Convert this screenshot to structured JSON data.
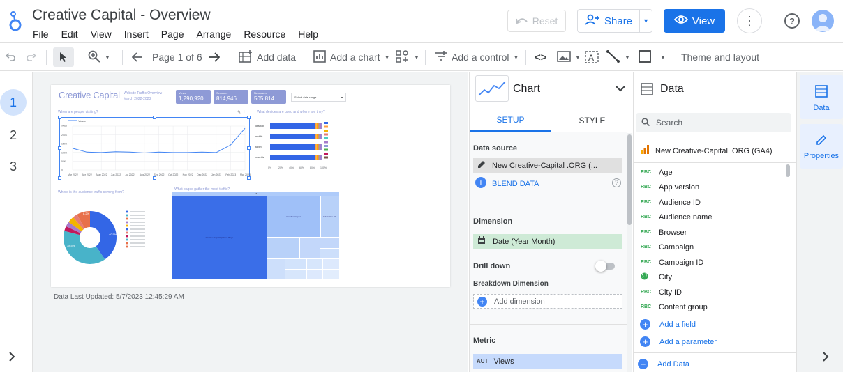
{
  "app": {
    "title": "Creative Capital - Overview",
    "menu": [
      "File",
      "Edit",
      "View",
      "Insert",
      "Page",
      "Arrange",
      "Resource",
      "Help"
    ],
    "reset_label": "Reset",
    "share_label": "Share",
    "view_label": "View"
  },
  "toolbar": {
    "page_indicator": "Page 1 of 6",
    "add_data": "Add data",
    "add_chart": "Add a chart",
    "add_control": "Add a control",
    "theme_layout": "Theme and layout"
  },
  "pages": [
    "1",
    "2",
    "3"
  ],
  "report": {
    "brand": "Creative Capital",
    "subtitle1": "Website Traffic Overview",
    "subtitle2": "March 2022-2023",
    "kpis": [
      {
        "label": "Views",
        "value": "1,290,920"
      },
      {
        "label": "Sessions",
        "value": "814,946"
      },
      {
        "label": "New users",
        "value": "505,814"
      }
    ],
    "date_selector": "Select date range",
    "q1": "When are people visiting?",
    "q2": "What devices are used and where are they?",
    "q3": "Where is the audience traffic coming from?",
    "q4": "What pages gather the most traffic?",
    "line_legend": "Views",
    "line_x": [
      "Mar 2022",
      "Apr 2022",
      "May 2022",
      "Jun 2022",
      "Jul 2022",
      "Aug 2022",
      "Sep 2022",
      "Oct 2022",
      "Nov 2022",
      "Dec 2022",
      "Jan 2023",
      "Feb 2023",
      "Mar 2023"
    ],
    "line_y_ticks": [
      "250K",
      "200K",
      "150K",
      "100K",
      "50K",
      "0"
    ],
    "device_categories": [
      "desktop",
      "mobile",
      "tablet",
      "smart tv"
    ],
    "device_x_ticks": [
      "0%",
      "20%",
      "40%",
      "60%",
      "80%",
      "100%"
    ],
    "pie_pct_large": "40.5%",
    "pie_pct_second": "38.5%",
    "pie_pct_third": "8.2%",
    "treemap_top": "All",
    "treemap_main": "Creative Capital | Home Page",
    "treemap_second": "Creative Capital",
    "treemap_third": "Education 101"
  },
  "last_updated": "Data Last Updated: 5/7/2023 12:45:29 AM",
  "chart_panel": {
    "title": "Chart",
    "tab_setup": "SETUP",
    "tab_style": "STYLE",
    "data_source_label": "Data source",
    "data_source_value": "New Creative-Capital .ORG (...",
    "blend_data": "BLEND DATA",
    "dimension_label": "Dimension",
    "dimension_value": "Date (Year Month)",
    "drill_down": "Drill down",
    "breakdown_label": "Breakdown Dimension",
    "add_dimension": "Add dimension",
    "metric_label": "Metric",
    "metric_tag": "AUT",
    "metric_value": "Views"
  },
  "data_panel": {
    "title": "Data",
    "search_placeholder": "Search",
    "source_name": "New Creative-Capital .ORG (GA4)",
    "fields": [
      {
        "type": "RBC",
        "name": "Age"
      },
      {
        "type": "RBC",
        "name": "App version"
      },
      {
        "type": "RBC",
        "name": "Audience ID"
      },
      {
        "type": "RBC",
        "name": "Audience name"
      },
      {
        "type": "RBC",
        "name": "Browser"
      },
      {
        "type": "RBC",
        "name": "Campaign"
      },
      {
        "type": "RBC",
        "name": "Campaign ID"
      },
      {
        "type": "geo",
        "name": "City"
      },
      {
        "type": "RBC",
        "name": "City ID"
      },
      {
        "type": "RBC",
        "name": "Content group"
      }
    ],
    "add_field": "Add a field",
    "add_parameter": "Add a parameter",
    "add_data": "Add Data"
  },
  "right_rail": {
    "data_tab": "Data",
    "properties_tab": "Properties"
  },
  "colors": {
    "accent": "#1a73e8",
    "kpi_bg": "#8e9ad6",
    "brand_text": "#8e9ad6",
    "pie_blue": "#3366e6",
    "pie_teal": "#48b3c9"
  }
}
